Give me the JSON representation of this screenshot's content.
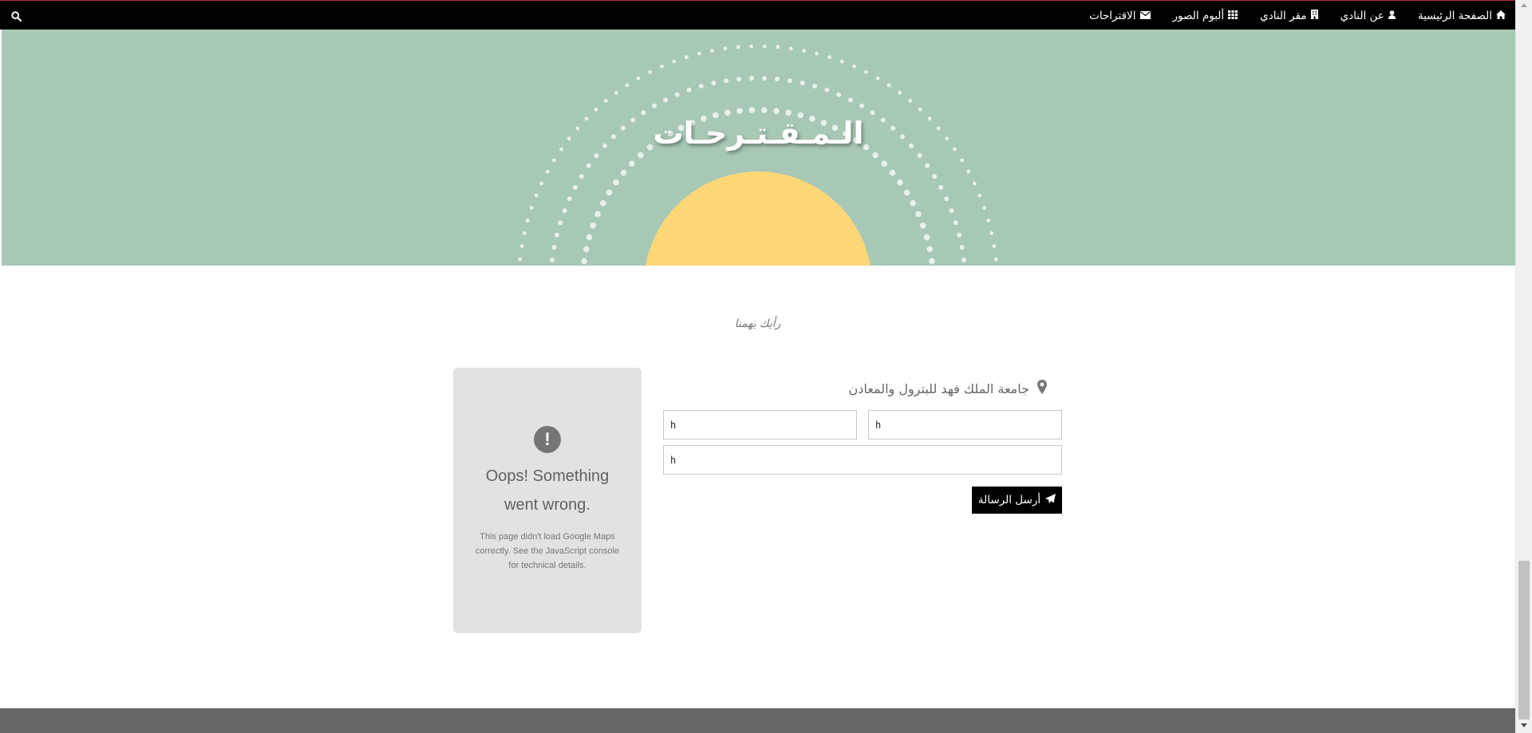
{
  "nav": {
    "items": [
      {
        "label": "الصفحة الرئيسية",
        "icon": "home-icon"
      },
      {
        "label": "عن النادي",
        "icon": "user-icon"
      },
      {
        "label": "مقر النادي",
        "icon": "building-icon"
      },
      {
        "label": "ألبوم الصور",
        "icon": "grid-icon"
      },
      {
        "label": "الاقتراحات",
        "icon": "envelope-icon"
      }
    ],
    "search_icon": "search-icon"
  },
  "hero": {
    "title": "الـمـقـتـرحـات",
    "background_color": "#a7c8b5",
    "sun_color": "#ffd777"
  },
  "subtitle": "رأيك يهمنا",
  "map_error": {
    "title": "Oops! Something went wrong.",
    "details": "This page didn't load Google Maps correctly. See the JavaScript console for technical details."
  },
  "contact": {
    "location": "جامعة الملك فهد للبترول والمعادن",
    "fields": {
      "name_value": "h",
      "email_value": "h",
      "message_value": "h"
    },
    "send_label": "أرسل الرسالة"
  }
}
